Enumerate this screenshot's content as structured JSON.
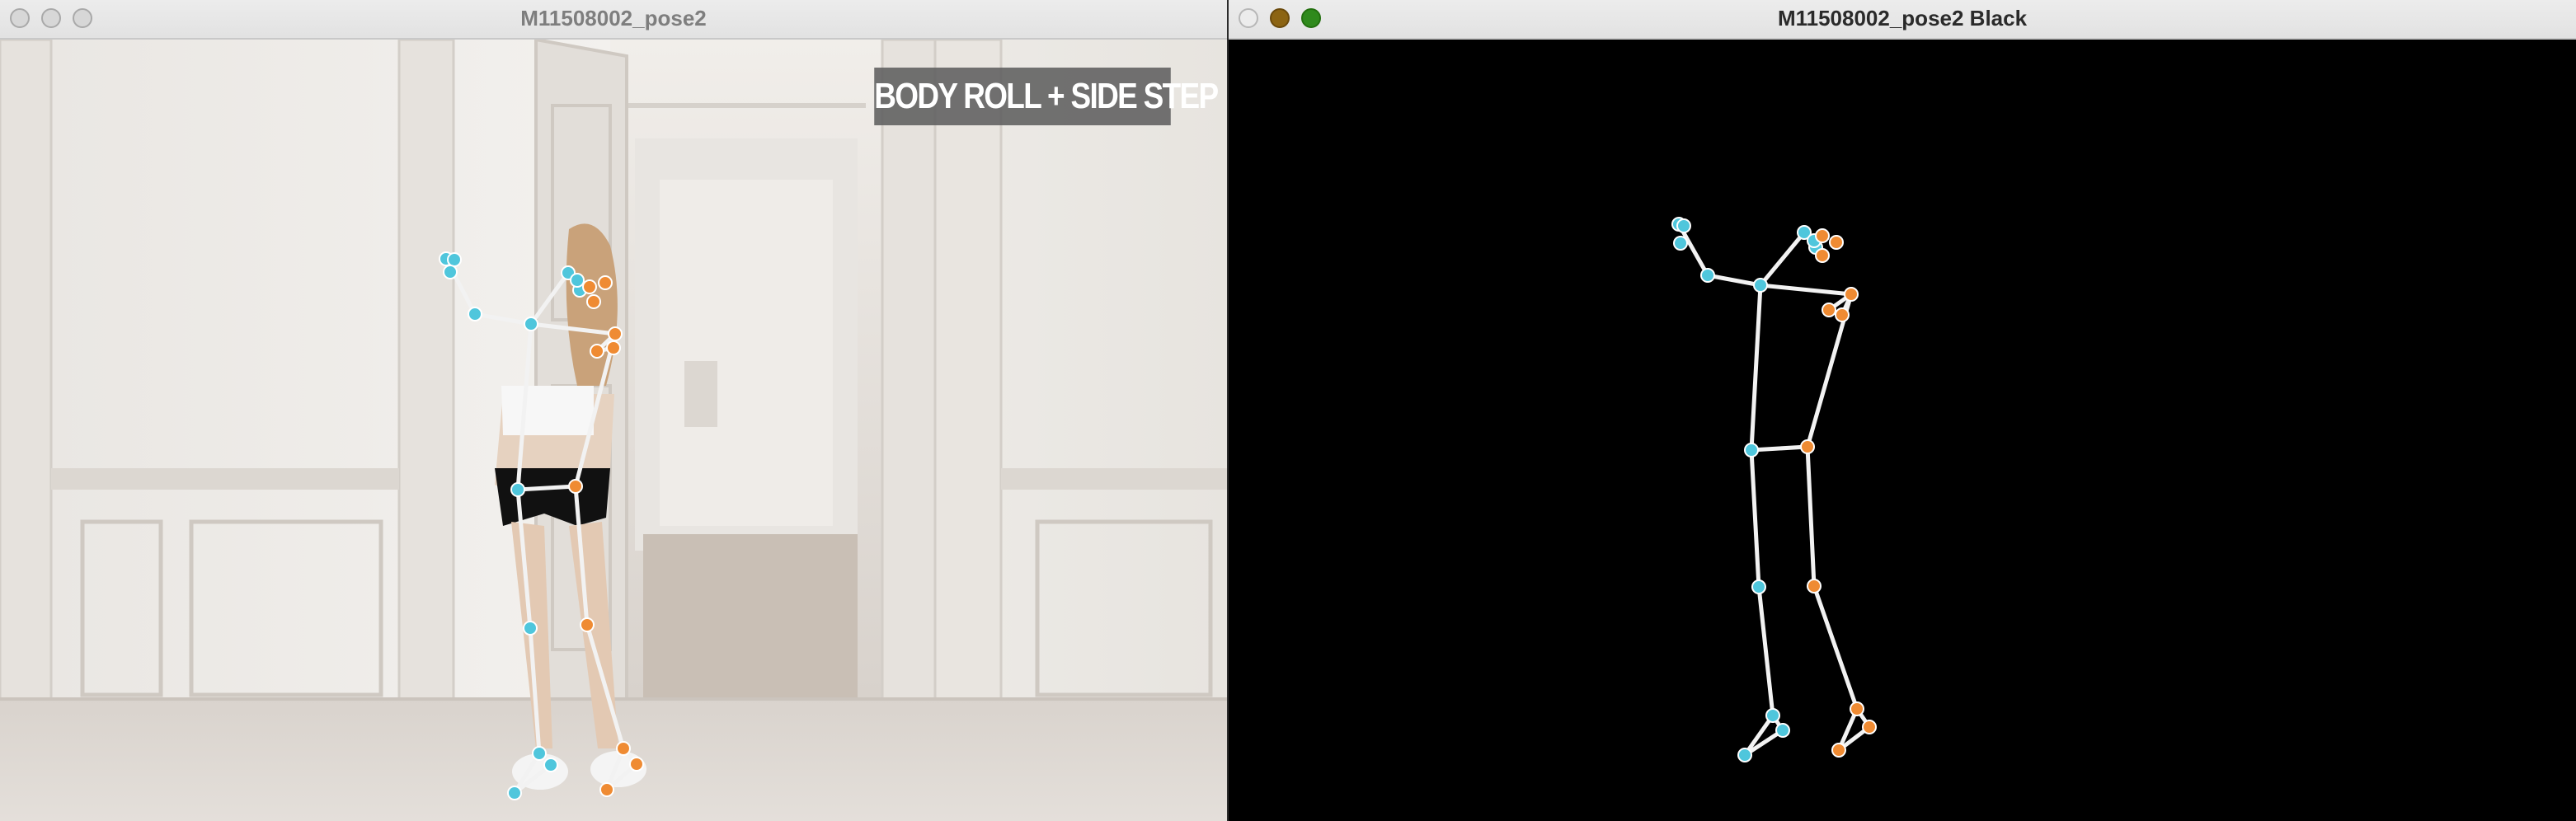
{
  "windows": [
    {
      "title": "M11508002_pose2",
      "caption": "BODY ROLL + SIDE STEP"
    },
    {
      "title": "M11508002_pose2 Black"
    }
  ],
  "colors": {
    "left_side_keypoint": "#4fc6dc",
    "right_side_keypoint": "#ef8b33",
    "skeleton_line": "#f2f2f2",
    "canvas_background": "#000000",
    "traffic_close": "#ececec",
    "traffic_minimize": "#8c6413",
    "traffic_zoom": "#2f8a1c"
  }
}
